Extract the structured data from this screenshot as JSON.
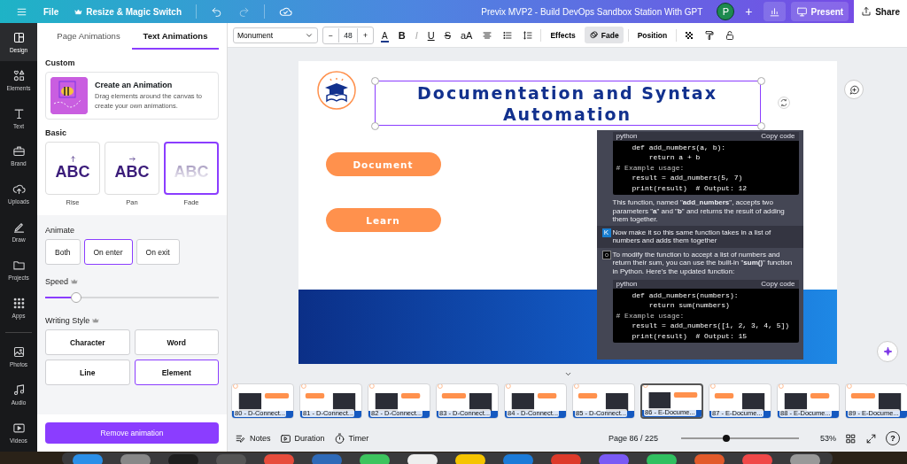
{
  "top_bar": {
    "file_menu": "File",
    "resize_button": "Resize & Magic Switch",
    "title": "Previx MVP2 - Build DevOps Sandbox Station  With GPT",
    "avatar": "P",
    "add_button": "+",
    "present_button": "Present",
    "share_button": "Share"
  },
  "rail": {
    "items": [
      {
        "label": "Design",
        "selected": true
      },
      {
        "label": "Elements",
        "selected": false
      },
      {
        "label": "Text",
        "selected": false
      },
      {
        "label": "Brand",
        "selected": false
      },
      {
        "label": "Uploads",
        "selected": false
      },
      {
        "label": "Draw",
        "selected": false
      },
      {
        "label": "Projects",
        "selected": false
      },
      {
        "label": "Apps",
        "selected": false
      }
    ],
    "more_items": [
      {
        "label": "Photos",
        "selected": false
      },
      {
        "label": "Audio",
        "selected": false
      },
      {
        "label": "Videos",
        "selected": false
      }
    ]
  },
  "panel": {
    "tabs": [
      {
        "label": "Page Animations",
        "selected": false
      },
      {
        "label": "Text Animations",
        "selected": true
      }
    ],
    "custom_heading": "Custom",
    "custom_card": {
      "title": "Create an Animation",
      "description": "Drag elements around the canvas to create your own animations."
    },
    "basic_heading": "Basic",
    "basic_options": [
      {
        "kind": "rise",
        "sample": "ABC",
        "label": "Rise",
        "selected": false
      },
      {
        "kind": "pan",
        "sample": "ABC",
        "label": "Pan",
        "selected": false
      },
      {
        "kind": "fade",
        "sample": "ABC",
        "label": "Fade",
        "selected": true
      }
    ],
    "animate_heading": "Animate",
    "animate_options": [
      {
        "label": "Both",
        "selected": false
      },
      {
        "label": "On enter",
        "selected": true
      },
      {
        "label": "On exit",
        "selected": false
      }
    ],
    "speed_heading": "Speed",
    "speed": {
      "level": 0.18
    },
    "writing_style_heading": "Writing Style",
    "writing_styles": [
      {
        "label": "Character",
        "selected": false
      },
      {
        "label": "Word",
        "selected": false
      },
      {
        "label": "Line",
        "selected": false
      },
      {
        "label": "Element",
        "selected": true
      }
    ],
    "remove_button": "Remove animation"
  },
  "toolbar": {
    "font": "Monument",
    "minus": "−",
    "font_size": "48",
    "plus": "+",
    "text_color": "A",
    "format_buttons": [
      {
        "label": "B",
        "kind": "bold",
        "disabled": false
      },
      {
        "label": "I",
        "kind": "italic",
        "disabled": true
      },
      {
        "label": "U",
        "kind": "underline",
        "disabled": false
      },
      {
        "label": "S",
        "kind": "strike",
        "disabled": false
      },
      {
        "label": "aA",
        "kind": "case",
        "disabled": false
      }
    ],
    "effects_button": "Effects",
    "fade_button": {
      "label": "Fade",
      "selected": true
    },
    "position_button": "Position"
  },
  "slide": {
    "title": "Documentation and Syntax Automation",
    "buttons": [
      "Document",
      "Learn"
    ],
    "chat_screenshot": [
      {
        "kind": "code",
        "language": "python",
        "copy": "Copy code",
        "lines": [
          {
            "kind": "code",
            "text": "def add_numbers(a, b):"
          },
          {
            "kind": "code",
            "text": "    return a + b"
          },
          {
            "kind": "comment",
            "text": "# Example usage:"
          },
          {
            "kind": "code",
            "text": "result = add_numbers(5, 7)"
          },
          {
            "kind": "code",
            "text": "print(result)  # Output: 12"
          }
        ]
      },
      {
        "kind": "text",
        "text": "This function, named \"**add_numbers**\", accepts two parameters \"**a**\" and \"**b**\" and returns the result of adding them together."
      },
      {
        "kind": "user",
        "avatar": "K",
        "text": "Now make it so this same function takes in a list of numbers and adds them together"
      },
      {
        "kind": "assistant",
        "text": "To modify the function to accept a list of numbers and return their sum, you can use the built-in \"**sum()**\" function in Python. Here's the updated function:"
      },
      {
        "kind": "code",
        "language": "python",
        "copy": "Copy code",
        "lines": [
          {
            "kind": "code",
            "text": "def add_numbers(numbers):"
          },
          {
            "kind": "code",
            "text": "    return sum(numbers)"
          },
          {
            "kind": "comment",
            "text": "# Example usage:"
          },
          {
            "kind": "code",
            "text": "result = add_numbers([1, 2, 3, 4, 5])"
          },
          {
            "kind": "code",
            "text": "print(result)  # Output: 15"
          }
        ]
      }
    ]
  },
  "thumbnails": [
    {
      "label": "80 - D-Connect...",
      "selected": false
    },
    {
      "label": "81 - D-Connect...",
      "selected": false
    },
    {
      "label": "82 - D-Connect...",
      "selected": false
    },
    {
      "label": "83 - D-Connect...",
      "selected": false
    },
    {
      "label": "84 - D-Connect...",
      "selected": false
    },
    {
      "label": "85 - D-Connect...",
      "selected": false
    },
    {
      "label": "86 - E-Docume...",
      "selected": true
    },
    {
      "label": "87 - E-Docume...",
      "selected": false
    },
    {
      "label": "88 - E-Docume...",
      "selected": false
    },
    {
      "label": "89 - E-Docume...",
      "selected": false
    }
  ],
  "bottom_bar": {
    "notes": "Notes",
    "duration": "Duration",
    "timer": "Timer",
    "page": "Page 86 / 225",
    "zoom": {
      "level": 0.38
    },
    "zoom_reading": "53%",
    "help": "?"
  }
}
